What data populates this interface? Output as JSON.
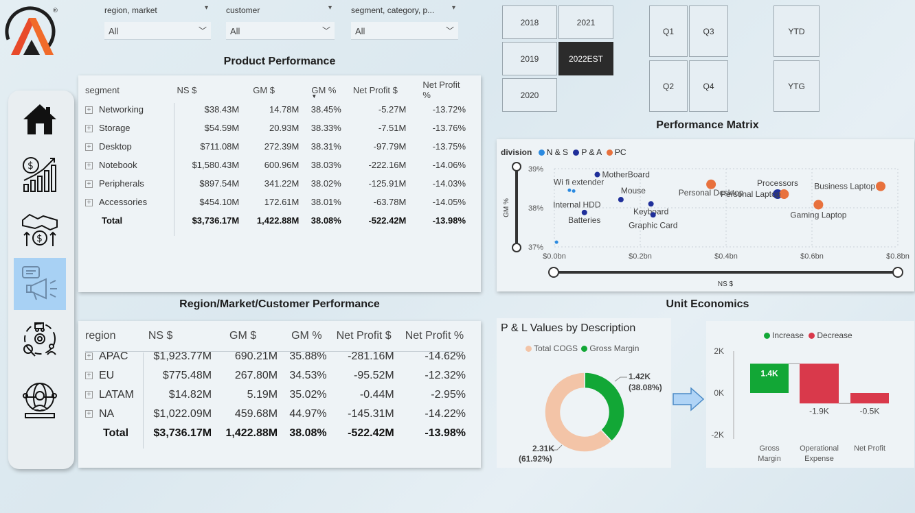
{
  "filters": [
    {
      "label": "region, market",
      "value": "All"
    },
    {
      "label": "customer",
      "value": "All"
    },
    {
      "label": "segment, category, p...",
      "value": "All"
    }
  ],
  "years": [
    {
      "label": "2018",
      "selected": false
    },
    {
      "label": "2021",
      "selected": false
    },
    {
      "label": "2019",
      "selected": false
    },
    {
      "label": "2022EST",
      "selected": true
    },
    {
      "label": "2020",
      "selected": false
    }
  ],
  "quarters": [
    "Q1",
    "Q3",
    "Q2",
    "Q4"
  ],
  "periods": [
    "YTD",
    "YTG"
  ],
  "nav": [
    {
      "icon": "home-icon"
    },
    {
      "icon": "finance-growth-icon"
    },
    {
      "icon": "deal-money-icon"
    },
    {
      "icon": "marketing-megaphone-icon",
      "active": true
    },
    {
      "icon": "supply-chain-icon"
    },
    {
      "icon": "customer-globe-icon"
    }
  ],
  "product_performance": {
    "title": "Product Performance",
    "columns": [
      "segment",
      "NS $",
      "GM $",
      "GM %",
      "Net Profit $",
      "Net Profit %"
    ],
    "rows": [
      [
        "Networking",
        "$38.43M",
        "14.78M",
        "38.45%",
        "-5.27M",
        "-13.72%"
      ],
      [
        "Storage",
        "$54.59M",
        "20.93M",
        "38.33%",
        "-7.51M",
        "-13.76%"
      ],
      [
        "Desktop",
        "$711.08M",
        "272.39M",
        "38.31%",
        "-97.79M",
        "-13.75%"
      ],
      [
        "Notebook",
        "$1,580.43M",
        "600.96M",
        "38.03%",
        "-222.16M",
        "-14.06%"
      ],
      [
        "Peripherals",
        "$897.54M",
        "341.22M",
        "38.02%",
        "-125.91M",
        "-14.03%"
      ],
      [
        "Accessories",
        "$454.10M",
        "172.61M",
        "38.01%",
        "-63.78M",
        "-14.05%"
      ]
    ],
    "total": [
      "Total",
      "$3,736.17M",
      "1,422.88M",
      "38.08%",
      "-522.42M",
      "-13.98%"
    ]
  },
  "region_performance": {
    "title": "Region/Market/Customer Performance",
    "columns": [
      "region",
      "NS $",
      "GM $",
      "GM %",
      "Net Profit $",
      "Net Profit %"
    ],
    "rows": [
      [
        "APAC",
        "$1,923.77M",
        "690.21M",
        "35.88%",
        "-281.16M",
        "-14.62%"
      ],
      [
        "EU",
        "$775.48M",
        "267.80M",
        "34.53%",
        "-95.52M",
        "-12.32%"
      ],
      [
        "LATAM",
        "$14.82M",
        "5.19M",
        "35.02%",
        "-0.44M",
        "-2.95%"
      ],
      [
        "NA",
        "$1,022.09M",
        "459.68M",
        "44.97%",
        "-145.31M",
        "-14.22%"
      ]
    ],
    "total": [
      "Total",
      "$3,736.17M",
      "1,422.88M",
      "38.08%",
      "-522.42M",
      "-13.98%"
    ]
  },
  "performance_matrix": {
    "title": "Performance Matrix",
    "legend_title": "division",
    "legend": [
      {
        "name": "N & S",
        "color": "#2b8ae0"
      },
      {
        "name": "P & A",
        "color": "#1f2f9a"
      },
      {
        "name": "PC",
        "color": "#e8713d"
      }
    ],
    "y_label": "GM %",
    "x_label": "NS $",
    "y_ticks": [
      "39%",
      "38%",
      "37%"
    ],
    "x_ticks": [
      "$0.0bn",
      "$0.2bn",
      "$0.4bn",
      "$0.6bn",
      "$0.8bn"
    ]
  },
  "unit_economics": {
    "title": "Unit Economics",
    "donut_title": "P & L Values by Description",
    "donut_legend": [
      {
        "name": "Total COGS",
        "color": "#f3c4a7"
      },
      {
        "name": "Gross Margin",
        "color": "#12a736"
      }
    ],
    "donut_labels": {
      "gm_value": "1.42K",
      "gm_pct": "(38.08%)",
      "cogs_value": "2.31K",
      "cogs_pct": "(61.92%)"
    },
    "waterfall_legend": [
      {
        "name": "Increase",
        "color": "#12a736"
      },
      {
        "name": "Decrease",
        "color": "#d9394b"
      }
    ],
    "waterfall_y_ticks": [
      "2K",
      "0K",
      "-2K"
    ],
    "waterfall_labels": {
      "gross": "1.4K",
      "opex": "-1.9K",
      "np": "-0.5K"
    },
    "waterfall_categories": [
      "Gross Margin",
      "Operational Expense",
      "Net Profit"
    ]
  },
  "chart_data": [
    {
      "type": "scatter",
      "title": "Performance Matrix",
      "xlabel": "NS $",
      "ylabel": "GM %",
      "xlim": [
        0,
        0.8
      ],
      "ylim": [
        37,
        39
      ],
      "series": [
        {
          "name": "N & S",
          "points": [
            {
              "label": "Wi fi extender",
              "x": 0.035,
              "y": 38.45
            },
            {
              "label": "Internal HDD",
              "x": 0.045,
              "y": 38.43
            },
            {
              "label": "",
              "x": 0.005,
              "y": 37.12
            }
          ]
        },
        {
          "name": "P & A",
          "points": [
            {
              "label": "MotherBoard",
              "x": 0.1,
              "y": 38.85
            },
            {
              "label": "Mouse",
              "x": 0.155,
              "y": 38.21
            },
            {
              "label": "Keyboard",
              "x": 0.225,
              "y": 38.1
            },
            {
              "label": "Graphic Card",
              "x": 0.23,
              "y": 37.82
            },
            {
              "label": "Batteries",
              "x": 0.07,
              "y": 37.88
            },
            {
              "label": "Processors",
              "x": 0.52,
              "y": 38.35
            }
          ]
        },
        {
          "name": "PC",
          "points": [
            {
              "label": "Personal Desktop",
              "x": 0.365,
              "y": 38.6
            },
            {
              "label": "Business Laptop",
              "x": 0.76,
              "y": 38.55
            },
            {
              "label": "Personal Laptop",
              "x": 0.535,
              "y": 38.35
            },
            {
              "label": "Gaming Laptop",
              "x": 0.615,
              "y": 38.08
            }
          ]
        }
      ]
    },
    {
      "type": "pie",
      "title": "P & L Values by Description",
      "categories": [
        "Total COGS",
        "Gross Margin"
      ],
      "values": [
        2.31,
        1.42
      ]
    },
    {
      "type": "bar",
      "categories": [
        "Gross Margin",
        "Operational Expense",
        "Net Profit"
      ],
      "values": [
        1.4,
        -1.9,
        -0.5
      ],
      "ylim": [
        -2,
        2
      ]
    }
  ]
}
